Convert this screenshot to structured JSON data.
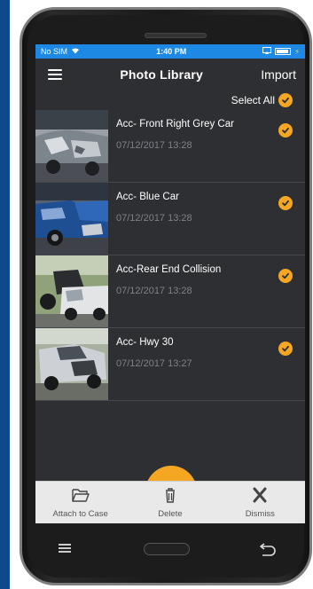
{
  "status_bar": {
    "carrier": "No SIM",
    "time": "1:40 PM"
  },
  "header": {
    "title": "Photo Library",
    "import_label": "Import"
  },
  "select_all": {
    "label": "Select All",
    "checked": true
  },
  "photos": [
    {
      "title": "Acc- Front Right Grey Car",
      "date": "07/12/2017 13:28",
      "checked": true
    },
    {
      "title": "Acc- Blue Car",
      "date": "07/12/2017 13:28",
      "checked": true
    },
    {
      "title": "Acc-Rear End Collision",
      "date": "07/12/2017 13:28",
      "checked": true
    },
    {
      "title": "Acc- Hwy 30",
      "date": "07/12/2017 13:27",
      "checked": true
    }
  ],
  "actions": {
    "attach_label": "Attach to Case",
    "delete_label": "Delete",
    "dismiss_label": "Dismiss"
  },
  "colors": {
    "accent": "#f5a623",
    "status_bar": "#1e88e5",
    "screen_bg": "#2e2f33",
    "action_bar": "#e9e9ea"
  },
  "icons": {
    "menu": "hamburger-icon",
    "check": "check-circle-icon",
    "attach": "folder-open-icon",
    "delete": "trash-icon",
    "dismiss": "close-icon"
  }
}
